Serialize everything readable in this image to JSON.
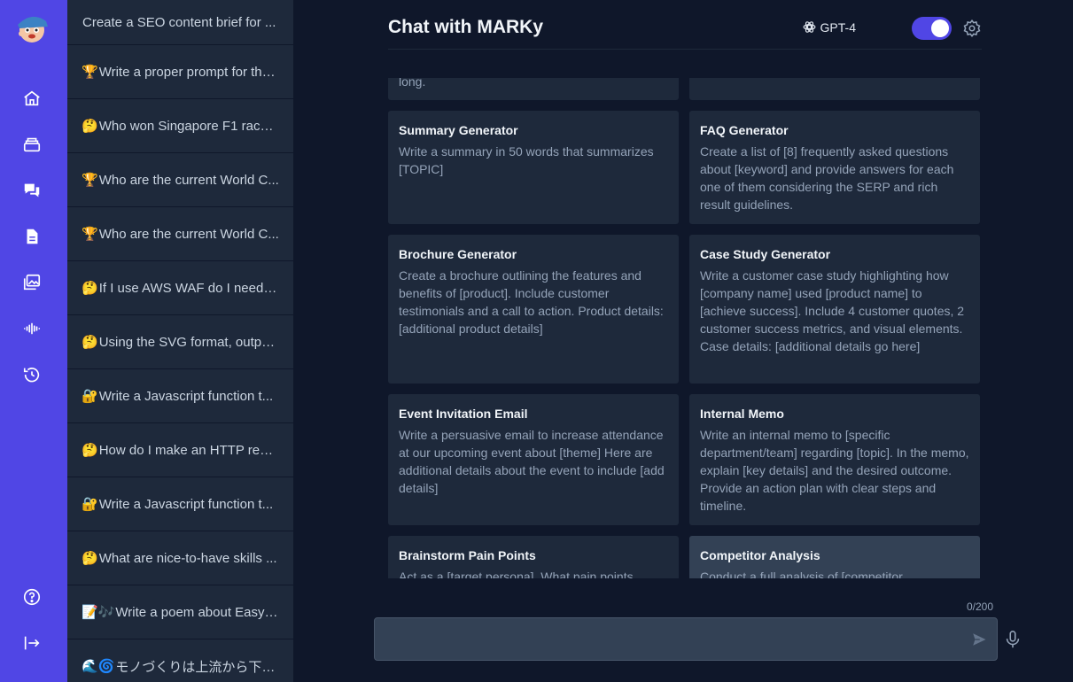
{
  "app": {
    "title": "Chat with MARKy",
    "model_label": "GPT-4",
    "model_toggle_on": true
  },
  "rail": {
    "top_icons": [
      "home-icon",
      "stack-icon",
      "chat-icon",
      "document-icon",
      "images-icon",
      "audio-wave-icon",
      "history-icon"
    ],
    "bottom_icons": [
      "help-icon",
      "logout-icon"
    ]
  },
  "history": [
    {
      "emoji": "",
      "text": "Create a SEO content brief for ..."
    },
    {
      "emoji": "🏆",
      "text": "Write a proper prompt for the..."
    },
    {
      "emoji": "🤔",
      "text": "Who won Singapore F1 race ..."
    },
    {
      "emoji": "🏆",
      "text": "Who are the current World C..."
    },
    {
      "emoji": "🏆",
      "text": "Who are the current World C..."
    },
    {
      "emoji": "🤔",
      "text": "If I use AWS WAF do I need s..."
    },
    {
      "emoji": "🤔",
      "text": "Using the SVG format, outpu..."
    },
    {
      "emoji": "🔐",
      "text": "Write a Javascript function t..."
    },
    {
      "emoji": "🤔",
      "text": "How do I make an HTTP requ..."
    },
    {
      "emoji": "🔐",
      "text": "Write a Javascript function t..."
    },
    {
      "emoji": "🤔",
      "text": "What are nice-to-have skills ..."
    },
    {
      "emoji": "📝🎶",
      "text": "Write a poem about Easy-..."
    },
    {
      "emoji": "🌊🌀",
      "text": "モノづくりは上流から下流..."
    }
  ],
  "cards": {
    "partial_top_left": "long.",
    "summary": {
      "title": "Summary Generator",
      "desc": "Write a summary in 50 words that summarizes [TOPIC]"
    },
    "faq": {
      "title": "FAQ Generator",
      "desc": "Create a list of [8] frequently asked questions about [keyword] and provide answers for each one of them considering the SERP and rich result guidelines."
    },
    "brochure": {
      "title": "Brochure Generator",
      "desc": "Create a brochure outlining the features and benefits of [product]. Include customer testimonials and a call to action. Product details: [additional product details]"
    },
    "case_study": {
      "title": "Case Study Generator",
      "desc": "Write a customer case study highlighting how [company name] used [product name] to [achieve success]. Include 4 customer quotes, 2 customer success metrics, and visual elements. Case details: [additional details go here]"
    },
    "event": {
      "title": "Event Invitation Email",
      "desc": "Write a persuasive email to increase attendance at our upcoming event about [theme] Here are additional details about the event to include [add details]"
    },
    "memo": {
      "title": "Internal Memo",
      "desc": "Write an internal memo to [specific department/team] regarding [topic]. In the memo, explain [key details] and the desired outcome. Provide an action plan with clear steps and timeline."
    },
    "brainstorm": {
      "title": "Brainstorm Pain Points",
      "desc": "Act as a [target persona]. What pain points"
    },
    "competitor": {
      "title": "Competitor Analysis",
      "desc": "Conduct a full analysis of [competitor"
    }
  },
  "composer": {
    "counter": "0/200",
    "value": "",
    "placeholder": ""
  },
  "colors": {
    "accent": "#5046e5",
    "background": "#0f172a",
    "panel": "#1e293b",
    "card_highlight": "#334155"
  }
}
